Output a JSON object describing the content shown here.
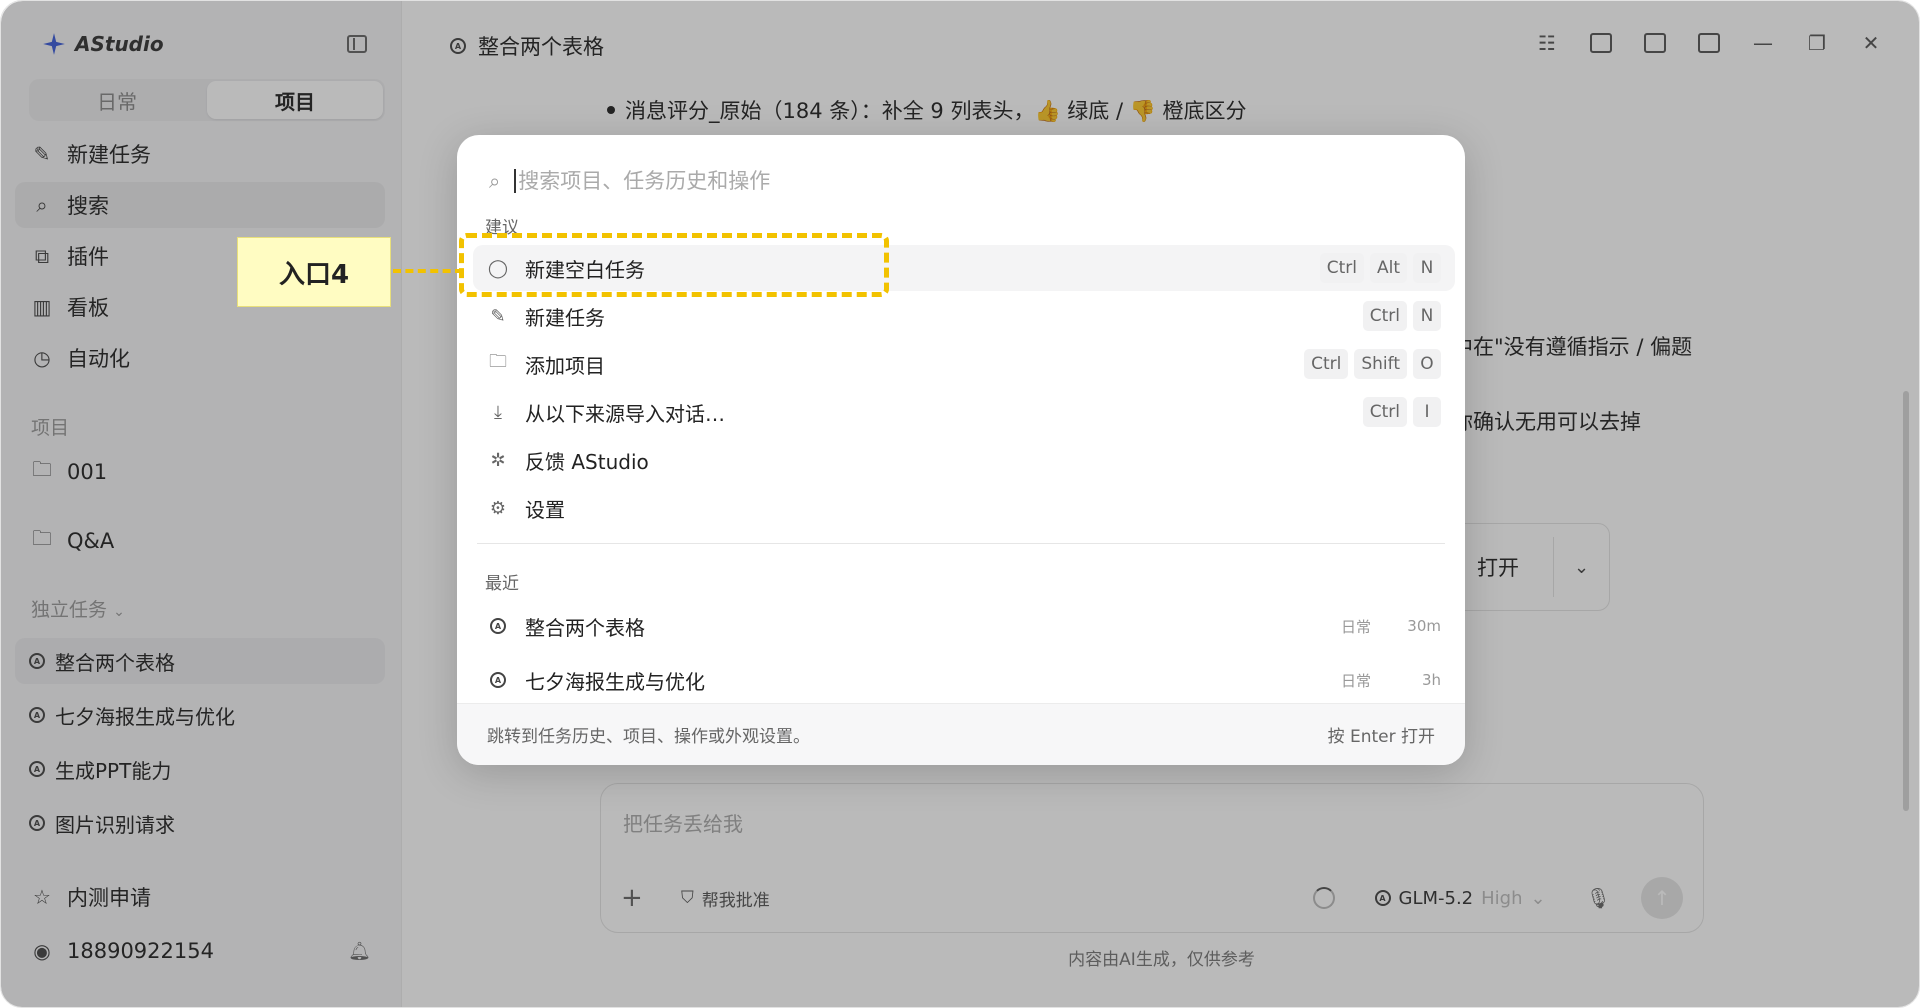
{
  "app": {
    "name": "AStudio"
  },
  "sidebar": {
    "tabs": [
      {
        "label": "日常"
      },
      {
        "label": "项目"
      }
    ],
    "nav": [
      {
        "label": "新建任务",
        "icon": "pencil-icon"
      },
      {
        "label": "搜索",
        "icon": "search-icon"
      },
      {
        "label": "插件",
        "icon": "plugin-icon"
      },
      {
        "label": "看板",
        "icon": "board-icon"
      },
      {
        "label": "自动化",
        "icon": "clock-icon"
      }
    ],
    "projects_label": "项目",
    "projects": [
      {
        "label": "001"
      },
      {
        "label": "Q&A"
      }
    ],
    "standalone_label": "独立任务",
    "tasks": [
      {
        "label": "整合两个表格"
      },
      {
        "label": "七夕海报生成与优化"
      },
      {
        "label": "生成PPT能力"
      },
      {
        "label": "图片识别请求"
      }
    ],
    "beta": "内测申请",
    "user": "18890922154"
  },
  "main": {
    "title": "整合两个表格",
    "bullet": "消息评分_原始（184 条）：补全 9 列表头，👍 绿底 / 👎 橙底区分",
    "bg_text_1": "中在\"没有遵循指示 / 偏题",
    "bg_text_2": "你确认无用可以去掉",
    "open_button": "打开",
    "composer": {
      "placeholder": "把任务丢给我",
      "approve": "帮我批准",
      "model": "GLM-5.2",
      "level": "High"
    },
    "disclaimer": "内容由AI生成，仅供参考"
  },
  "palette": {
    "search_placeholder": "搜索项目、任务历史和操作",
    "suggest_label": "建议",
    "commands": [
      {
        "label": "新建空白任务",
        "icon": "chat-bubble-icon",
        "keys": [
          "Ctrl",
          "Alt",
          "N"
        ]
      },
      {
        "label": "新建任务",
        "icon": "pencil-icon",
        "keys": [
          "Ctrl",
          "N"
        ]
      },
      {
        "label": "添加项目",
        "icon": "folder-icon",
        "keys": [
          "Ctrl",
          "Shift",
          "O"
        ]
      },
      {
        "label": "从以下来源导入对话…",
        "icon": "download-icon",
        "keys": [
          "Ctrl",
          "I"
        ]
      },
      {
        "label": "反馈 AStudio",
        "icon": "bug-icon",
        "keys": []
      },
      {
        "label": "设置",
        "icon": "gear-icon",
        "keys": []
      }
    ],
    "recent_label": "最近",
    "recent": [
      {
        "label": "整合两个表格",
        "tag": "日常",
        "time": "30m"
      },
      {
        "label": "七夕海报生成与优化",
        "tag": "日常",
        "time": "3h"
      }
    ],
    "footer_hint": "跳转到任务历史、项目、操作或外观设置。",
    "footer_action": "按 Enter 打开"
  },
  "annotation": {
    "label": "入口4",
    "color": "#f2c200"
  }
}
